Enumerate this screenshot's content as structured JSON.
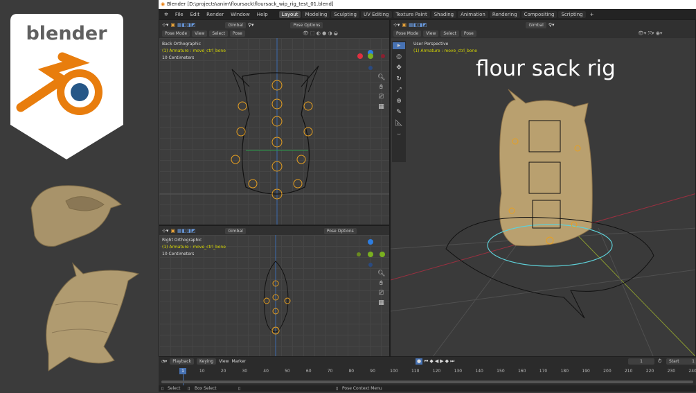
{
  "branding": {
    "logo_text": "blender",
    "accent": "#e87d0d",
    "logo_blue": "#265787"
  },
  "window": {
    "title": "Blender [D:\\projects\\anim\\floursack\\floursack_wip_rig_test_01.blend]"
  },
  "menu": [
    "File",
    "Edit",
    "Render",
    "Window",
    "Help"
  ],
  "workspaces": [
    "Layout",
    "Modeling",
    "Sculpting",
    "UV Editing",
    "Texture Paint",
    "Shading",
    "Animation",
    "Rendering",
    "Compositing",
    "Scripting",
    "+"
  ],
  "active_workspace": "Layout",
  "header": {
    "mode": "Pose Mode",
    "view": "View",
    "select": "Select",
    "pose": "Pose",
    "orientation": "Gimbal",
    "pose_options": "Pose Options"
  },
  "viewports": {
    "top_left": {
      "view": "Back Orthographic",
      "object": "(1) Armature : move_ctrl_bone",
      "scale": "10 Centimeters"
    },
    "bottom_left": {
      "view": "Right Orthographic",
      "object": "(1) Armature : move_ctrl_bone",
      "scale": "10 Centimeters"
    },
    "right": {
      "view": "User Perspective",
      "object": "(1) Armature : move_ctrl_bone",
      "overlay_title": "flour sack rig"
    }
  },
  "gizmo_axes": {
    "x": "X",
    "y": "Y",
    "z": "Z"
  },
  "timeline": {
    "playback": "Playback",
    "keying": "Keying",
    "view": "View",
    "marker": "Marker",
    "current_frame": "1",
    "start_label": "Start",
    "start_value": "1",
    "ticks": [
      "1",
      "10",
      "20",
      "30",
      "40",
      "50",
      "60",
      "70",
      "80",
      "90",
      "100",
      "110",
      "120",
      "130",
      "140",
      "150",
      "160",
      "170",
      "180",
      "190",
      "200",
      "210",
      "220",
      "230",
      "240"
    ]
  },
  "status": {
    "select": "Select",
    "box_select": "Box Select",
    "context_menu": "Pose Context Menu"
  }
}
